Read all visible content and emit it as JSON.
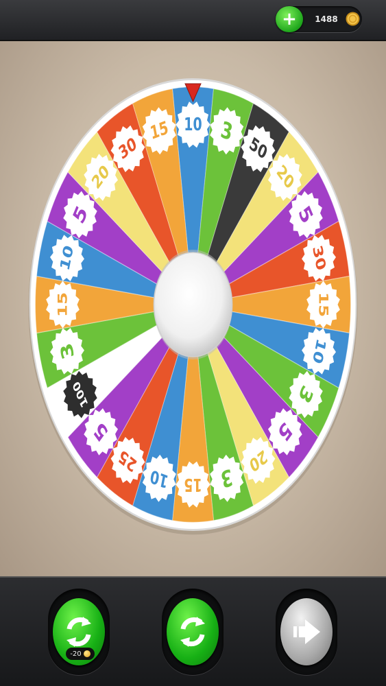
{
  "topbar": {
    "add_coins_label": "+",
    "coin_balance": "1488"
  },
  "wheel": {
    "pointer_color": "#d8281e",
    "segments": [
      {
        "value": "10",
        "color": "#3f8fd2"
      },
      {
        "value": "3",
        "color": "#6cc23a"
      },
      {
        "value": "50",
        "color": "#3a3a3a"
      },
      {
        "value": "20",
        "color": "#f3e27a"
      },
      {
        "value": "5",
        "color": "#a23fc7"
      },
      {
        "value": "30",
        "color": "#e8552a"
      },
      {
        "value": "15",
        "color": "#f2a53a"
      },
      {
        "value": "10",
        "color": "#3f8fd2"
      },
      {
        "value": "3",
        "color": "#6cc23a"
      },
      {
        "value": "5",
        "color": "#a23fc7"
      },
      {
        "value": "20",
        "color": "#f3e27a"
      },
      {
        "value": "3",
        "color": "#6cc23a"
      },
      {
        "value": "15",
        "color": "#f2a53a"
      },
      {
        "value": "10",
        "color": "#3f8fd2"
      },
      {
        "value": "25",
        "color": "#e8552a"
      },
      {
        "value": "5",
        "color": "#a23fc7"
      },
      {
        "value": "100",
        "color": "#ffffff"
      },
      {
        "value": "3",
        "color": "#6cc23a"
      },
      {
        "value": "15",
        "color": "#f2a53a"
      },
      {
        "value": "10",
        "color": "#3f8fd2"
      },
      {
        "value": "5",
        "color": "#a23fc7"
      },
      {
        "value": "20",
        "color": "#f3e27a"
      },
      {
        "value": "30",
        "color": "#e8552a"
      },
      {
        "value": "15",
        "color": "#f2a53a"
      }
    ]
  },
  "controls": {
    "paid_spin_cost": "-20",
    "paid_spin_icon": "refresh-arrows-icon",
    "free_spin_icon": "refresh-arrows-icon",
    "next_icon": "arrow-right-icon"
  }
}
